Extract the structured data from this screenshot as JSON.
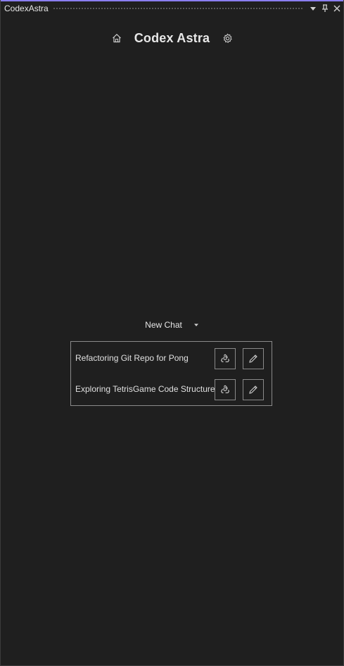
{
  "window": {
    "title": "CodexAstra",
    "accent_color": "#8a7ef0",
    "background_color": "#1f1f1f"
  },
  "titlebar_controls": [
    {
      "name": "dropdown-icon"
    },
    {
      "name": "pin-icon"
    },
    {
      "name": "close-icon"
    }
  ],
  "header": {
    "title": "Codex Astra",
    "left_icon": "home-icon",
    "right_icon": "settings-gear-icon"
  },
  "new_chat": {
    "label": "New Chat",
    "icon": "caret-down-icon"
  },
  "chats": [
    {
      "title": "Refactoring Git Repo for Pong",
      "actions": [
        "recycle-icon",
        "pencil-icon"
      ]
    },
    {
      "title": "Exploring TetrisGame Code Structure",
      "actions": [
        "recycle-icon",
        "pencil-icon"
      ]
    }
  ]
}
